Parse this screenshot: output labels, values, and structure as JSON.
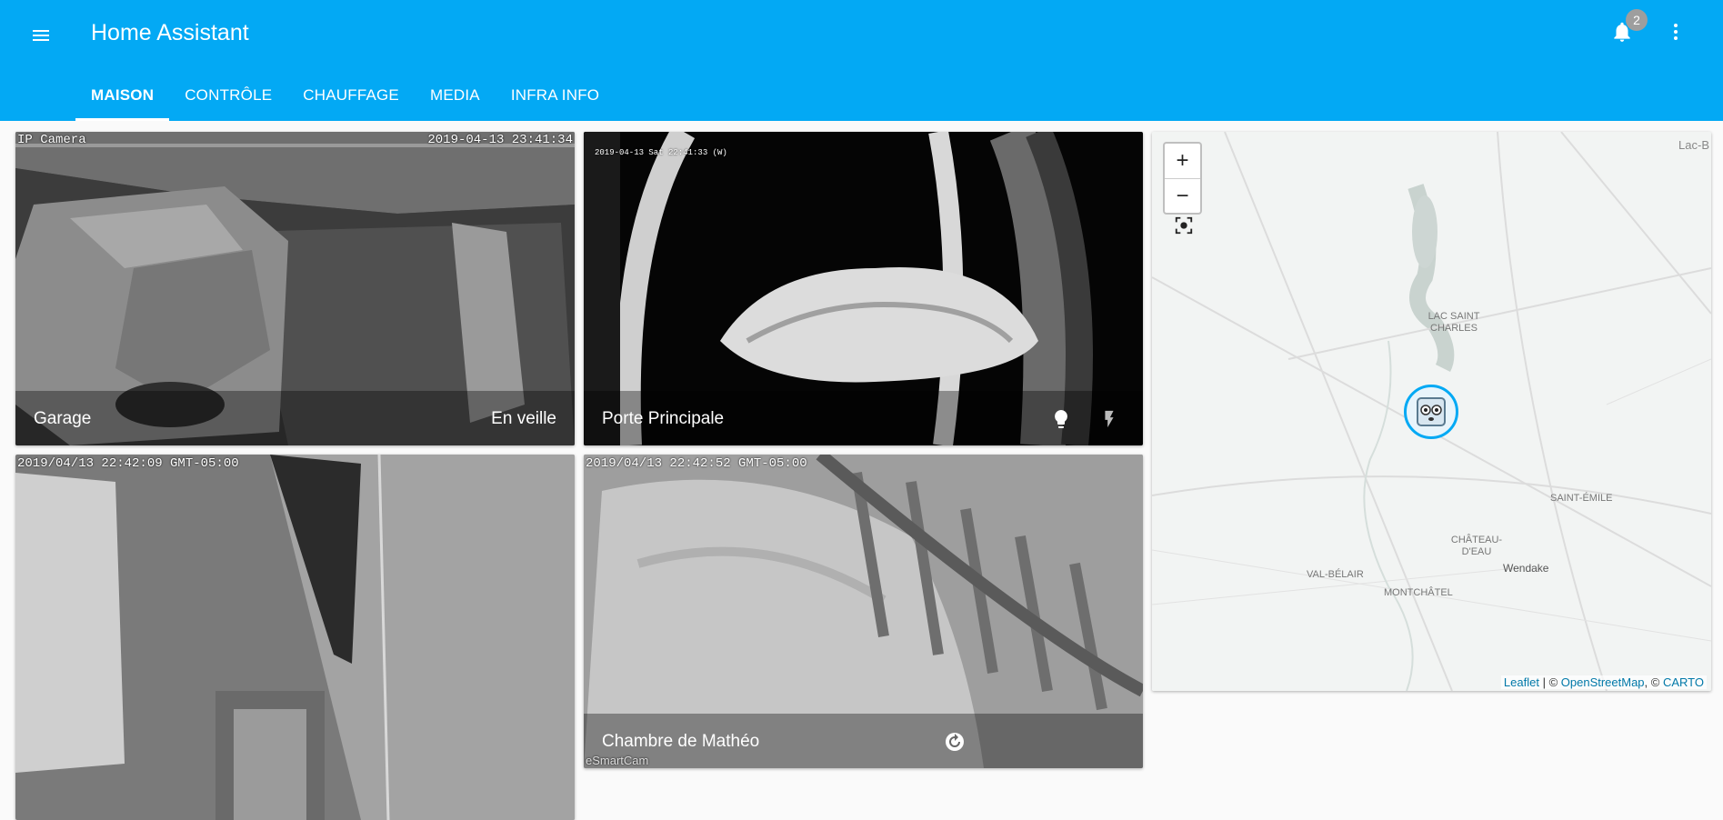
{
  "header": {
    "title": "Home Assistant",
    "notification_count": "2",
    "icons": {
      "menu": "menu-icon",
      "bell": "bell-icon",
      "more": "dots-vertical-icon"
    }
  },
  "tabs": [
    {
      "label": "MAISON",
      "active": true
    },
    {
      "label": "CONTRÔLE",
      "active": false
    },
    {
      "label": "CHAUFFAGE",
      "active": false
    },
    {
      "label": "MEDIA",
      "active": false
    },
    {
      "label": "INFRA INFO",
      "active": false
    }
  ],
  "cameras": {
    "garage": {
      "name": "Garage",
      "state": "En veille",
      "stamp_left": "IP Camera",
      "stamp_right": "2019-04-13 23:41:34"
    },
    "front_door": {
      "name": "Porte Principale",
      "stamp": "2019-04-13 Sat 22:41:33 (W)",
      "icons": [
        "lightbulb-icon",
        "flash-icon"
      ]
    },
    "room": {
      "stamp": "2019/04/13 22:42:09 GMT-05:00"
    },
    "matheo": {
      "name": "Chambre de Mathéo",
      "stamp": "2019/04/13 22:42:52 GMT-05:00",
      "watermark": "eSmartCam",
      "icon": "restart-icon"
    }
  },
  "map": {
    "zoom_in": "+",
    "zoom_out": "−",
    "labels": {
      "lac_b": "Lac-B",
      "lac_saint_charles": "LAC SAINT CHARLES",
      "saint_emile": "SAINT-ÉMILE",
      "chateau_deau": "CHÂTEAU-D'EAU",
      "wendake": "Wendake",
      "val_belair": "VAL-BÉLAIR",
      "montchatel": "MONTCHÂTEL"
    },
    "attribution": {
      "leaflet": "Leaflet",
      "sep1": " | © ",
      "osm": "OpenStreetMap",
      "sep2": ", © ",
      "carto": "CARTO"
    }
  },
  "colors": {
    "primary": "#03a9f4",
    "accent_link": "#0078a8"
  }
}
